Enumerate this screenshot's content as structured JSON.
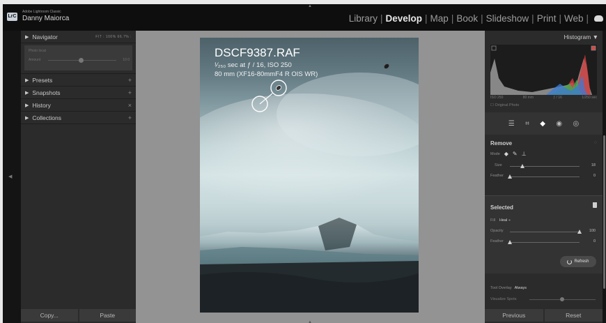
{
  "app": {
    "logo": "LrC",
    "name": "Adobe Lightroom Classic",
    "user": "Danny Maiorca"
  },
  "modules": [
    "Library",
    "Develop",
    "Map",
    "Book",
    "Slideshow",
    "Print",
    "Web"
  ],
  "active_module": "Develop",
  "left_panel": {
    "navigator": {
      "label": "Navigator",
      "zoom": "FIT :  100%   66.7%  :"
    },
    "nav_preview": {
      "line1": "Photo locat",
      "line2": "Amount",
      "value": "10 0"
    },
    "sections": [
      {
        "label": "Presets",
        "action": "+"
      },
      {
        "label": "Snapshots",
        "action": "+"
      },
      {
        "label": "History",
        "action": "×"
      },
      {
        "label": "Collections",
        "action": "+"
      }
    ],
    "copy_button": "Copy...",
    "paste_button": "Paste"
  },
  "photo": {
    "filename": "DSCF9387.RAF",
    "exposure": "¹⁄₂₅₀ sec at ƒ / 16, ISO 250",
    "lens": "80 mm (XF16-80mmF4 R OIS WR)"
  },
  "right_panel": {
    "histogram_label": "Histogram",
    "hist_meta": [
      "ISO 250",
      "80 mm",
      "ƒ / 16",
      "1/250 sec"
    ],
    "original_photo": "Original Photo",
    "remove": {
      "title": "Remove",
      "mode_label": "Mode",
      "size_label": "Size",
      "size_value": "18",
      "size_fraction": 0.18,
      "feather_label": "Feather",
      "feather_value": "0",
      "feather_fraction": 0.0
    },
    "selected": {
      "title": "Selected",
      "fill_label": "Fill",
      "fill_value": "Heal ÷",
      "opacity_label": "Opacity",
      "opacity_value": "100",
      "opacity_fraction": 1.0,
      "feather_label": "Feather",
      "feather_value": "0",
      "feather_fraction": 0.0,
      "refresh_label": "Refresh"
    },
    "tool_overlay_label": "Tool Overlay",
    "tool_overlay_value": "Always",
    "visualize_spots": "Visualize Spots",
    "previous_button": "Previous",
    "reset_button": "Reset"
  },
  "colors": {
    "panel": "#2b2b2b",
    "canvas": "#939393",
    "active_text": "#e8e8e8"
  }
}
